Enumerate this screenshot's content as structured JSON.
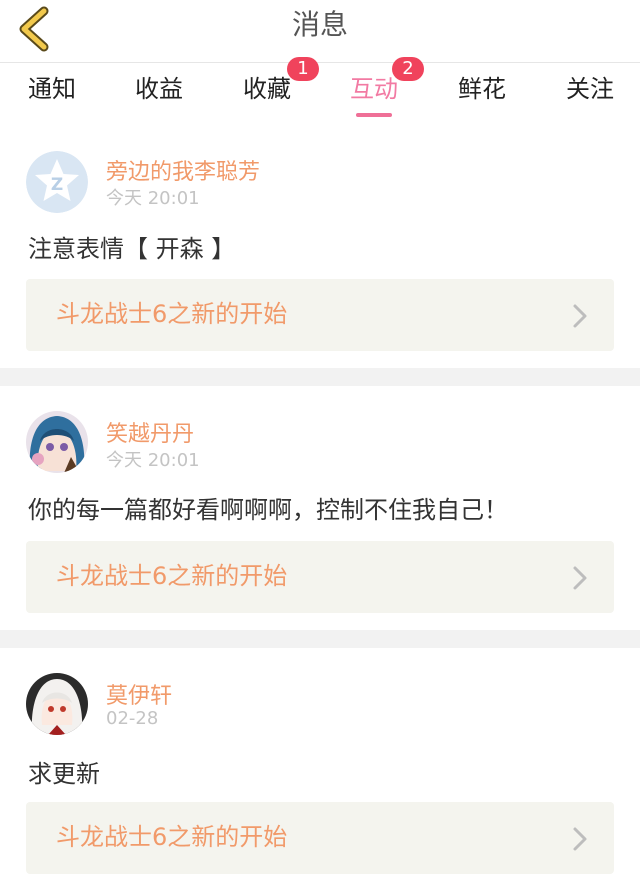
{
  "header": {
    "title": "消息"
  },
  "tabs": [
    {
      "label": "通知"
    },
    {
      "label": "收益"
    },
    {
      "label": "收藏",
      "badge": "1"
    },
    {
      "label": "互动",
      "badge": "2",
      "active": true
    },
    {
      "label": "鲜花"
    },
    {
      "label": "关注"
    }
  ],
  "messages": [
    {
      "name": "旁边的我李聪芳",
      "time": "今天 20:01",
      "text": "注意表情【 开森 】",
      "link": "斗龙战士6之新的开始",
      "avatar_icon": "qq-star-avatar-icon"
    },
    {
      "name": "笑越丹丹",
      "time": "今天 20:01",
      "text": "你的每一篇都好看啊啊啊，控制不住我自己！",
      "link": "斗龙战士6之新的开始",
      "avatar_icon": "anime-girl-avatar-icon"
    },
    {
      "name": "莫伊轩",
      "time": "02-28",
      "text": "求更新",
      "link": "斗龙战士6之新的开始",
      "avatar_icon": "anime-white-hair-avatar-icon"
    }
  ],
  "colors": {
    "accent": "#f27aa3",
    "name_orange": "#f19a6a",
    "badge_red": "#f0435c",
    "back_arrow": "#f2c94c"
  }
}
